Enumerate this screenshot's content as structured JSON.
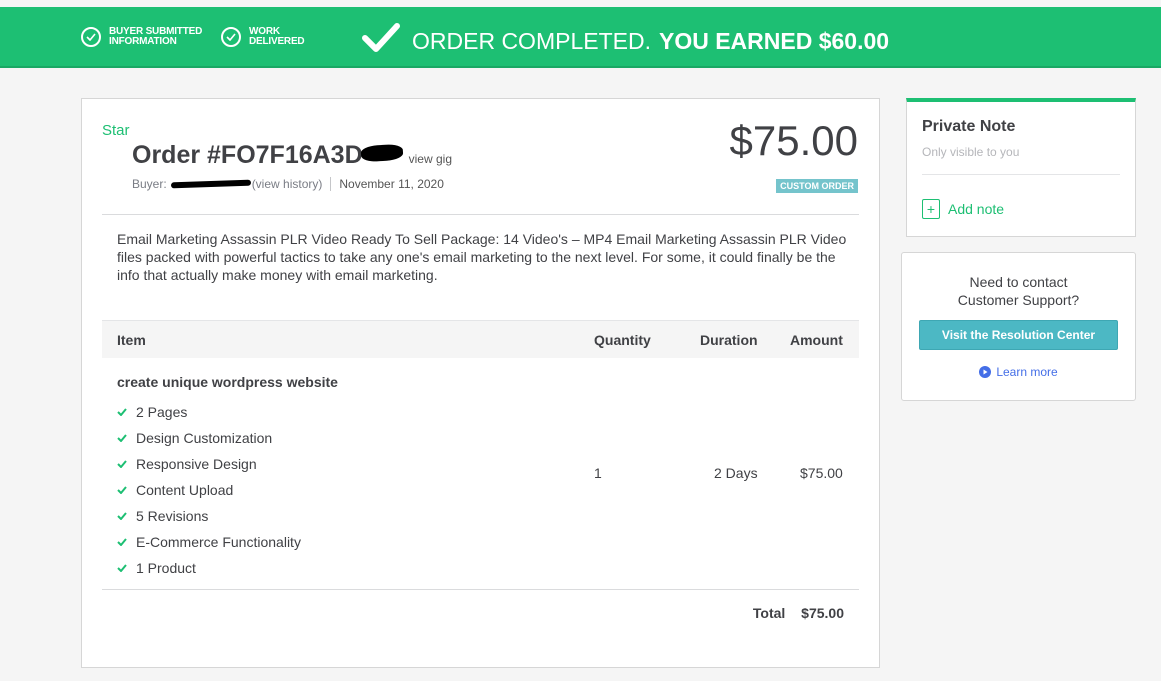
{
  "banner": {
    "steps": [
      {
        "line1": "BUYER SUBMITTED",
        "line2": "INFORMATION"
      },
      {
        "line1": "WORK",
        "line2": "DELIVERED"
      }
    ],
    "headline_thin": "ORDER COMPLETED.",
    "headline_bold": "YOU EARNED $60.00"
  },
  "order": {
    "seller": "Star",
    "title": "Order #FO7F16A3D",
    "view_gig": "view gig",
    "buyer_label": "Buyer:",
    "view_history": "(view history)",
    "date": "November 11, 2020",
    "price": "$75.00",
    "badge": "CUSTOM ORDER",
    "description": "Email Marketing Assassin PLR Video Ready To Sell Package: 14 Video's – MP4 Email Marketing Assassin PLR Video files packed with powerful tactics to take any one's email marketing to the next level. For some, it could finally be the info that actually make money with email marketing."
  },
  "table": {
    "headers": {
      "item": "Item",
      "quantity": "Quantity",
      "duration": "Duration",
      "amount": "Amount"
    },
    "row": {
      "name": "create unique wordpress website",
      "features": [
        "2 Pages",
        "Design Customization",
        "Responsive Design",
        "Content Upload",
        "5 Revisions",
        "E-Commerce Functionality",
        "1 Product"
      ],
      "quantity": "1",
      "duration": "2 Days",
      "amount": "$75.00"
    },
    "total_label": "Total",
    "total_value": "$75.00"
  },
  "private_note": {
    "title": "Private Note",
    "subtitle": "Only visible to you",
    "add_label": "Add note"
  },
  "support": {
    "line1": "Need to contact",
    "line2": "Customer Support?",
    "button": "Visit the Resolution Center",
    "learn_more": "Learn more"
  },
  "colors": {
    "brand_green": "#1dbf73",
    "badge_teal": "#75c4cc",
    "button_teal": "#4cb8c4",
    "link_blue": "#446ee7"
  }
}
